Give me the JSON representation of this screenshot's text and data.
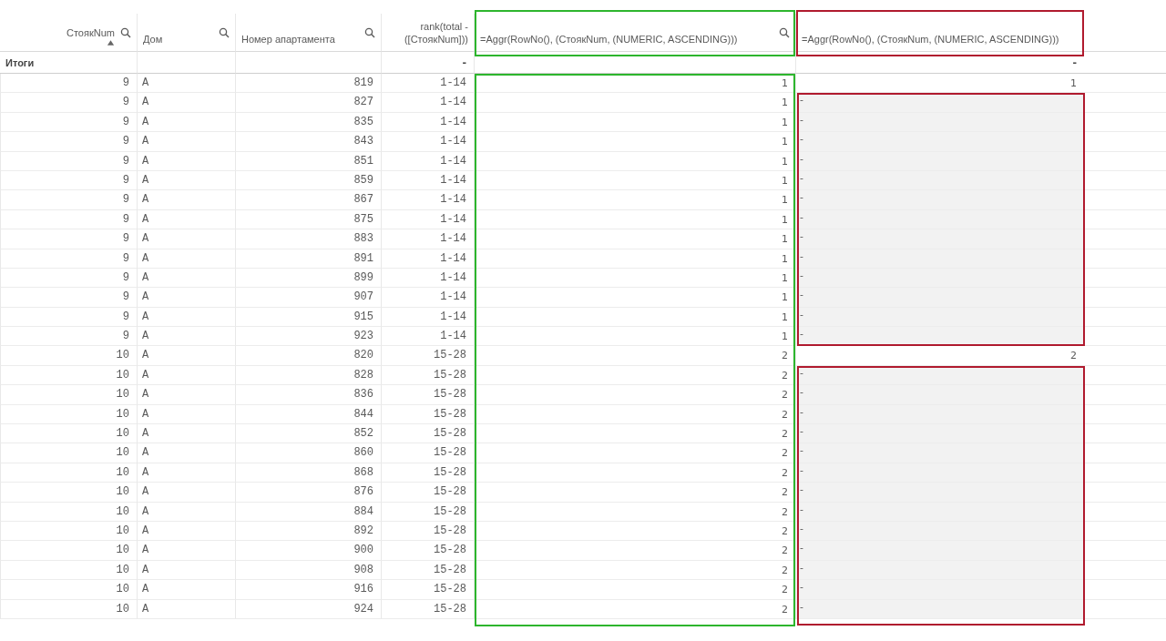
{
  "table": {
    "columns": [
      {
        "title": "СтоякNum",
        "search": true,
        "sorted": true,
        "total": "Итоги"
      },
      {
        "title": "Дом",
        "search": true,
        "sorted": false
      },
      {
        "title": "Номер апартамента",
        "search": true,
        "sorted": false
      },
      {
        "title": "rank(total - ([СтоякNum]))",
        "search": false,
        "sorted": false,
        "total": "-"
      },
      {
        "title": "=Aggr(RowNo(), (СтоякNum, (NUMERIC, ASCENDING)))",
        "search": true,
        "sorted": false,
        "frame": {
          "color": "#2db52d"
        }
      },
      {
        "title": "=Aggr(RowNo(), (СтоякNum, (NUMERIC, ASCENDING)))",
        "search": false,
        "sorted": false,
        "total": "-",
        "frame": {
          "color": "#b01a2e"
        }
      }
    ],
    "rows": [
      {
        "cells": [
          "9",
          "A",
          "819",
          "1-14",
          "1",
          "1"
        ],
        "highlighted": false
      },
      {
        "cells": [
          "9",
          "A",
          "827",
          "1-14",
          "1",
          "-"
        ],
        "highlighted": true
      },
      {
        "cells": [
          "9",
          "A",
          "835",
          "1-14",
          "1",
          "-"
        ],
        "highlighted": true
      },
      {
        "cells": [
          "9",
          "A",
          "843",
          "1-14",
          "1",
          "-"
        ],
        "highlighted": true
      },
      {
        "cells": [
          "9",
          "A",
          "851",
          "1-14",
          "1",
          "-"
        ],
        "highlighted": true
      },
      {
        "cells": [
          "9",
          "A",
          "859",
          "1-14",
          "1",
          "-"
        ],
        "highlighted": true
      },
      {
        "cells": [
          "9",
          "A",
          "867",
          "1-14",
          "1",
          "-"
        ],
        "highlighted": true
      },
      {
        "cells": [
          "9",
          "A",
          "875",
          "1-14",
          "1",
          "-"
        ],
        "highlighted": true
      },
      {
        "cells": [
          "9",
          "A",
          "883",
          "1-14",
          "1",
          "-"
        ],
        "highlighted": true
      },
      {
        "cells": [
          "9",
          "A",
          "891",
          "1-14",
          "1",
          "-"
        ],
        "highlighted": true
      },
      {
        "cells": [
          "9",
          "A",
          "899",
          "1-14",
          "1",
          "-"
        ],
        "highlighted": true
      },
      {
        "cells": [
          "9",
          "A",
          "907",
          "1-14",
          "1",
          "-"
        ],
        "highlighted": true
      },
      {
        "cells": [
          "9",
          "A",
          "915",
          "1-14",
          "1",
          "-"
        ],
        "highlighted": true
      },
      {
        "cells": [
          "9",
          "A",
          "923",
          "1-14",
          "1",
          "-"
        ],
        "highlighted": true
      },
      {
        "cells": [
          "10",
          "A",
          "820",
          "15-28",
          "2",
          "2"
        ],
        "highlighted": false
      },
      {
        "cells": [
          "10",
          "A",
          "828",
          "15-28",
          "2",
          "-"
        ],
        "highlighted": true
      },
      {
        "cells": [
          "10",
          "A",
          "836",
          "15-28",
          "2",
          "-"
        ],
        "highlighted": true
      },
      {
        "cells": [
          "10",
          "A",
          "844",
          "15-28",
          "2",
          "-"
        ],
        "highlighted": true
      },
      {
        "cells": [
          "10",
          "A",
          "852",
          "15-28",
          "2",
          "-"
        ],
        "highlighted": true
      },
      {
        "cells": [
          "10",
          "A",
          "860",
          "15-28",
          "2",
          "-"
        ],
        "highlighted": true
      },
      {
        "cells": [
          "10",
          "A",
          "868",
          "15-28",
          "2",
          "-"
        ],
        "highlighted": true
      },
      {
        "cells": [
          "10",
          "A",
          "876",
          "15-28",
          "2",
          "-"
        ],
        "highlighted": true
      },
      {
        "cells": [
          "10",
          "A",
          "884",
          "15-28",
          "2",
          "-"
        ],
        "highlighted": true
      },
      {
        "cells": [
          "10",
          "A",
          "892",
          "15-28",
          "2",
          "-"
        ],
        "highlighted": true
      },
      {
        "cells": [
          "10",
          "A",
          "900",
          "15-28",
          "2",
          "-"
        ],
        "highlighted": true
      },
      {
        "cells": [
          "10",
          "A",
          "908",
          "15-28",
          "2",
          "-"
        ],
        "highlighted": true
      },
      {
        "cells": [
          "10",
          "A",
          "916",
          "15-28",
          "2",
          "-"
        ],
        "highlighted": true
      },
      {
        "cells": [
          "10",
          "A",
          "924",
          "15-28",
          "2",
          "-"
        ],
        "highlighted": true
      }
    ]
  }
}
